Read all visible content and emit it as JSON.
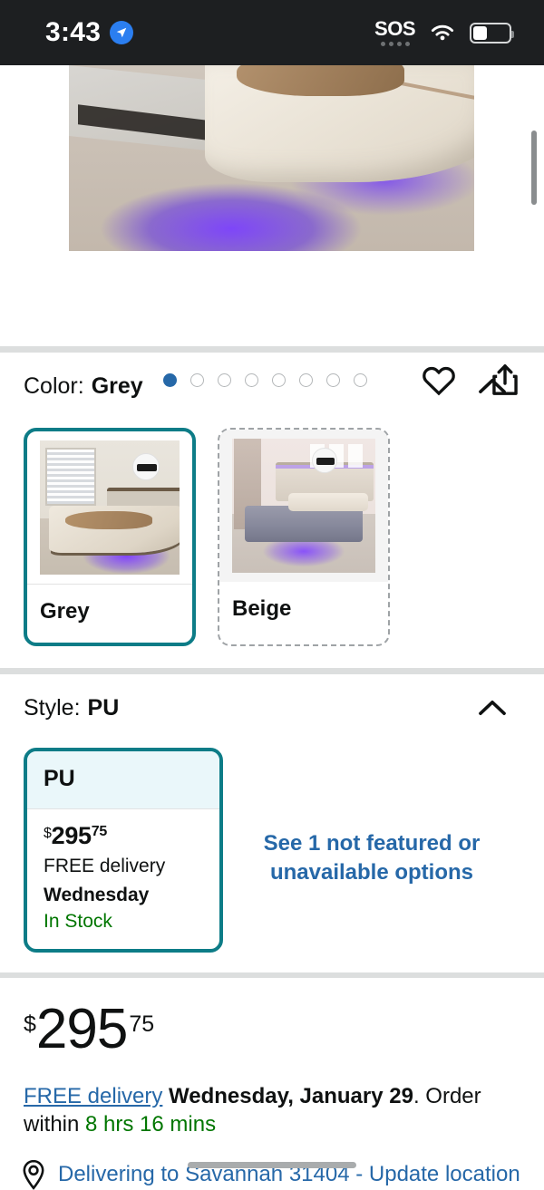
{
  "status_bar": {
    "time": "3:43",
    "location_arrow_icon": "location-arrow-icon",
    "sos_label": "SOS",
    "wifi_icon": "wifi-icon",
    "battery_icon": "battery-icon"
  },
  "gallery": {
    "dot_count": 8,
    "active_index": 0,
    "wishlist_icon": "heart-icon",
    "share_icon": "share-icon",
    "image_alt": "Bed with purple LED underglow lighting on carpet"
  },
  "color_section": {
    "label": "Color:",
    "selected_value": "Grey",
    "collapse_icon": "chevron-up-icon",
    "options": [
      {
        "label": "Grey",
        "selected": true
      },
      {
        "label": "Beige",
        "selected": false
      }
    ]
  },
  "style_section": {
    "label": "Style:",
    "selected_value": "PU",
    "collapse_icon": "chevron-up-icon",
    "card": {
      "title": "PU",
      "price_currency": "$",
      "price_whole": "295",
      "price_cents": "75",
      "delivery_line": "FREE delivery",
      "delivery_day": "Wednesday",
      "stock_status": "In Stock"
    },
    "not_featured_link": "See 1 not featured or unavailable options"
  },
  "price": {
    "currency": "$",
    "whole": "295",
    "cents": "75"
  },
  "delivery_info": {
    "free_delivery_link": "FREE delivery",
    "date": "Wednesday, January 29",
    "order_within_prefix": ". Order within",
    "countdown": "8 hrs 16 mins"
  },
  "location": {
    "pin_icon": "location-pin-icon",
    "text": "Delivering to Savannah 31404 - Update location"
  },
  "colors": {
    "accent_teal": "#0d7c87",
    "link_blue": "#2668a8",
    "stock_green": "#007600",
    "status_bar_bg": "#1d1f21",
    "divider": "#dcdede"
  }
}
